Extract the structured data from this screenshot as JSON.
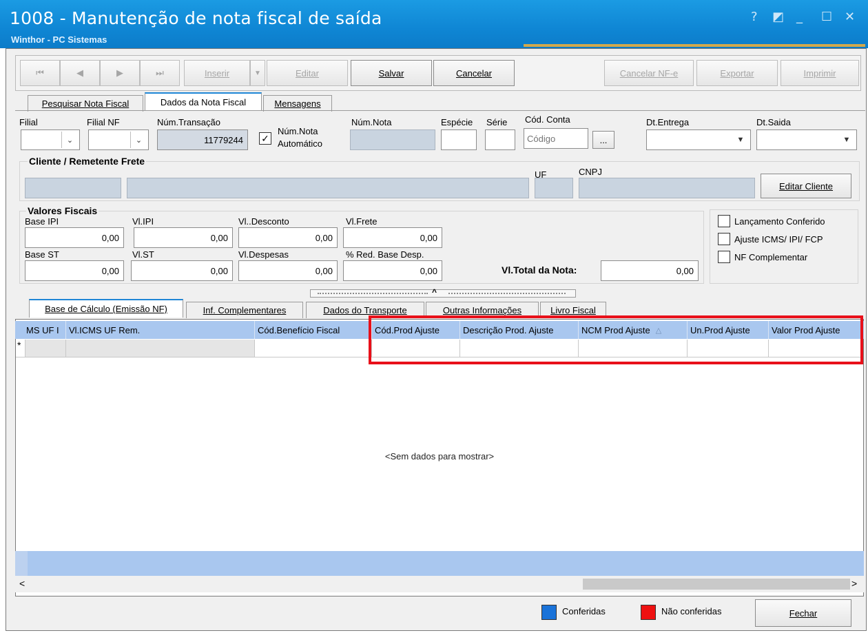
{
  "window": {
    "title": "1008 - Manutenção de nota fiscal de saída",
    "subtitle": "Winthor - PC Sistemas",
    "controls": [
      "?",
      "◩",
      "_",
      "☐",
      "✕"
    ]
  },
  "toolbar": {
    "first": "⏮",
    "prev": "◀",
    "next": "▶",
    "last": "⏭",
    "inserir": "Inserir",
    "inserir_drop": "▼",
    "editar": "Editar",
    "salvar": "Salvar",
    "cancelar": "Cancelar",
    "cancelar_nfe": "Cancelar NF-e",
    "exportar": "Exportar",
    "imprimir": "Imprimir"
  },
  "tabs": [
    "Pesquisar Nota Fiscal",
    "Dados da Nota Fiscal",
    "Mensagens"
  ],
  "fields": {
    "filial": "Filial",
    "filial_nf": "Filial NF",
    "num_transacao": "Núm.Transação",
    "num_transacao_value": "11779244",
    "num_nota_auto": [
      "Núm.Nota",
      "Automático"
    ],
    "num_nota_auto_checked": true,
    "num_nota": "Núm.Nota",
    "especie": "Espécie",
    "serie": "Série",
    "cod_conta": "Cód. Conta",
    "cod_conta_placeholder": "Código",
    "browse_button": "...",
    "dt_entrega": "Dt.Entrega",
    "dt_saida": "Dt.Saida"
  },
  "cliente": {
    "title": "Cliente / Remetente Frete",
    "uf": "UF",
    "cnpj": "CNPJ",
    "editar_button": "Editar Cliente"
  },
  "valores": {
    "title": "Valores Fiscais",
    "row1": [
      {
        "label": "Base IPI",
        "value": "0,00"
      },
      {
        "label": "Vl.IPI",
        "value": "0,00"
      },
      {
        "label": "Vl..Desconto",
        "value": "0,00"
      },
      {
        "label": "Vl.Frete",
        "value": "0,00"
      }
    ],
    "row2": [
      {
        "label": "Base ST",
        "value": "0,00"
      },
      {
        "label": "Vl.ST",
        "value": "0,00"
      },
      {
        "label": "Vl.Despesas",
        "value": "0,00"
      },
      {
        "label": "% Red. Base Desp.",
        "value": "0,00"
      }
    ],
    "total_label": "Vl.Total da Nota:",
    "total_value": "0,00"
  },
  "checkboxes": [
    "Lançamento Conferido",
    "Ajuste ICMS/ IPI/ FCP",
    "NF Complementar"
  ],
  "subtabs": [
    "Base de Cálculo (Emissão NF)",
    "Inf. Complementares",
    "Dados do Transporte",
    "Outras Informações",
    "Livro Fiscal"
  ],
  "grid": {
    "columns": [
      "MS UF I",
      "Vl.ICMS UF Rem.",
      "Cód.Benefício Fiscal",
      "Cód.Prod Ajuste",
      "Descrição Prod. Ajuste",
      "NCM Prod Ajuste",
      "Un.Prod Ajuste",
      "Valor Prod Ajuste"
    ],
    "new_row_marker": "*",
    "sort_indicator": "△",
    "empty_text": "<Sem dados para mostrar>",
    "scroll_left": "<",
    "scroll_right": ">",
    "highlight_color": "#e8101a"
  },
  "footer": {
    "legend": [
      {
        "label": "Conferidas",
        "color": "#1a73d9"
      },
      {
        "label": "Não conferidas",
        "color": "#ee1111"
      }
    ],
    "fechar": "Fechar"
  },
  "splitter_glyph": "^"
}
